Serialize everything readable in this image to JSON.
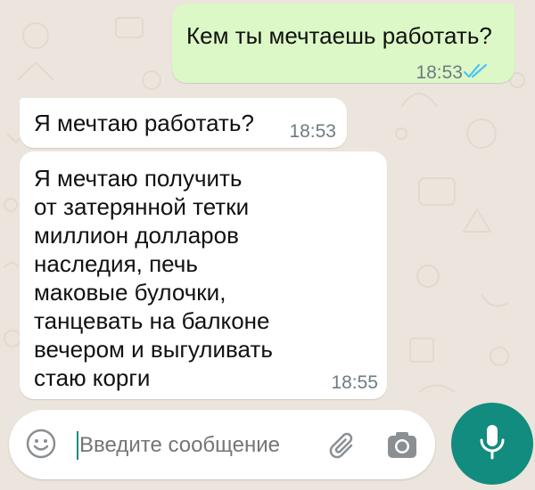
{
  "colors": {
    "background": "#ece5dd",
    "outgoing_bubble": "#dcf8c6",
    "incoming_bubble": "#ffffff",
    "accent": "#128c7e",
    "read_ticks": "#4fc3f7"
  },
  "messages": [
    {
      "direction": "outgoing",
      "text": "Кем ты мечтаешь работать?",
      "time": "18:53",
      "status": "read"
    },
    {
      "direction": "incoming",
      "text": "Я мечтаю работать?",
      "time": "18:53"
    },
    {
      "direction": "incoming",
      "text": "Я мечтаю получить\nот затерянной тетки\nмиллион долларов\nнаследия, печь\nмаковые булочки,\nтанцевать на балконе\nвечером и выгуливать\nстаю корги",
      "time": "18:55"
    }
  ],
  "composer": {
    "placeholder": "Введите сообщение",
    "icons": [
      "emoji-icon",
      "attach-icon",
      "camera-icon",
      "microphone-icon"
    ]
  }
}
